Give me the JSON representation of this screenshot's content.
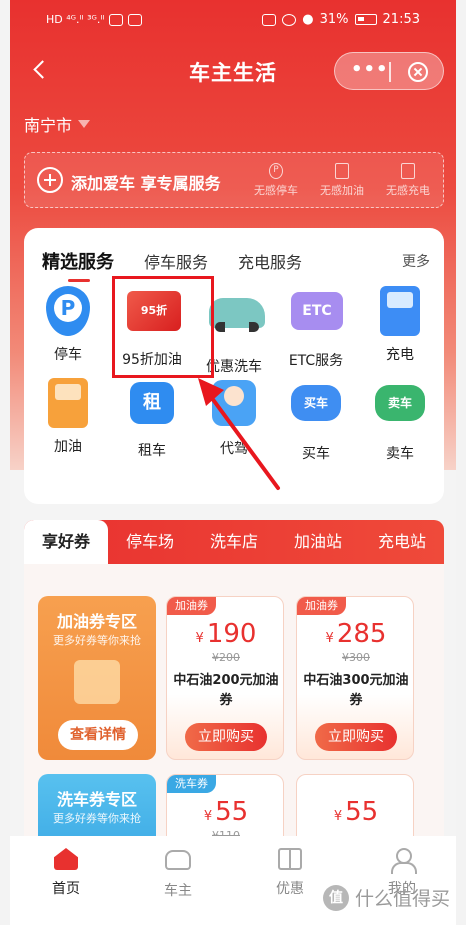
{
  "status_bar": {
    "signal_left": "HD ⁴ᴳ.ᴵᴵ ³ᴳ.ᴵᴵ",
    "battery_percent": "31%",
    "time": "21:53"
  },
  "navbar": {
    "title": "车主生活",
    "more_label": "•••"
  },
  "city": "南宁市",
  "add_car": {
    "label": "添加爱车 享专属服务",
    "features": [
      {
        "icon": "parking-icon",
        "glyph": "P",
        "label": "无感停车"
      },
      {
        "icon": "fuel-icon",
        "glyph": "",
        "label": "无感加油"
      },
      {
        "icon": "charger-icon",
        "glyph": "",
        "label": "无感充电"
      }
    ]
  },
  "services": {
    "tabs": [
      "精选服务",
      "停车服务",
      "充电服务"
    ],
    "more": "更多",
    "items": [
      {
        "name": "停车",
        "icon": "parking-icon"
      },
      {
        "name": "95折加油",
        "icon": "coupon-icon",
        "badge": "95折"
      },
      {
        "name": "优惠洗车",
        "icon": "car-wash-icon"
      },
      {
        "name": "ETC服务",
        "icon": "etc-icon",
        "badge": "ETC"
      },
      {
        "name": "充电",
        "icon": "charger-icon"
      },
      {
        "name": "加油",
        "icon": "gas-pump-icon"
      },
      {
        "name": "租车",
        "icon": "rent-car-icon",
        "badge": "租"
      },
      {
        "name": "代驾",
        "icon": "driver-icon"
      },
      {
        "name": "买车",
        "icon": "buy-car-icon",
        "badge": "买车"
      },
      {
        "name": "卖车",
        "icon": "sell-car-icon",
        "badge": "卖车"
      }
    ],
    "highlight_color": "#e8171e"
  },
  "coupons": {
    "tabs": [
      "享好券",
      "停车场",
      "洗车店",
      "加油站",
      "充电站"
    ],
    "promos": [
      {
        "title": "加油券专区",
        "subtitle": "更多好券等你来抢",
        "button": "查看详情",
        "color": "#f49a4e"
      },
      {
        "title": "洗车券专区",
        "subtitle": "更多好券等你来抢",
        "color": "#4fb7ea"
      }
    ],
    "cards": [
      {
        "tag": "加油券",
        "currency": "¥",
        "price": "190",
        "old_price": "¥200",
        "name": "中石油200元加油券",
        "button": "立即购买"
      },
      {
        "tag": "加油券",
        "currency": "¥",
        "price": "285",
        "old_price": "¥300",
        "name": "中石油300元加油券",
        "button": "立即购买"
      },
      {
        "tag": "洗车券",
        "currency": "¥",
        "price": "55",
        "old_price": "¥110"
      },
      {
        "tag": "",
        "currency": "¥",
        "price": "55",
        "old_price": ""
      }
    ]
  },
  "tabbar": {
    "items": [
      {
        "label": "首页",
        "icon": "home-icon",
        "active": true
      },
      {
        "label": "车主",
        "icon": "car-icon"
      },
      {
        "label": "优惠",
        "icon": "gift-icon"
      },
      {
        "label": "我的",
        "icon": "user-icon"
      }
    ]
  },
  "watermark": {
    "logo": "值",
    "text": "什么值得买"
  },
  "colors": {
    "brand_red": "#e8312f",
    "accent_orange": "#f49a4e",
    "accent_blue": "#4fb7ea"
  }
}
